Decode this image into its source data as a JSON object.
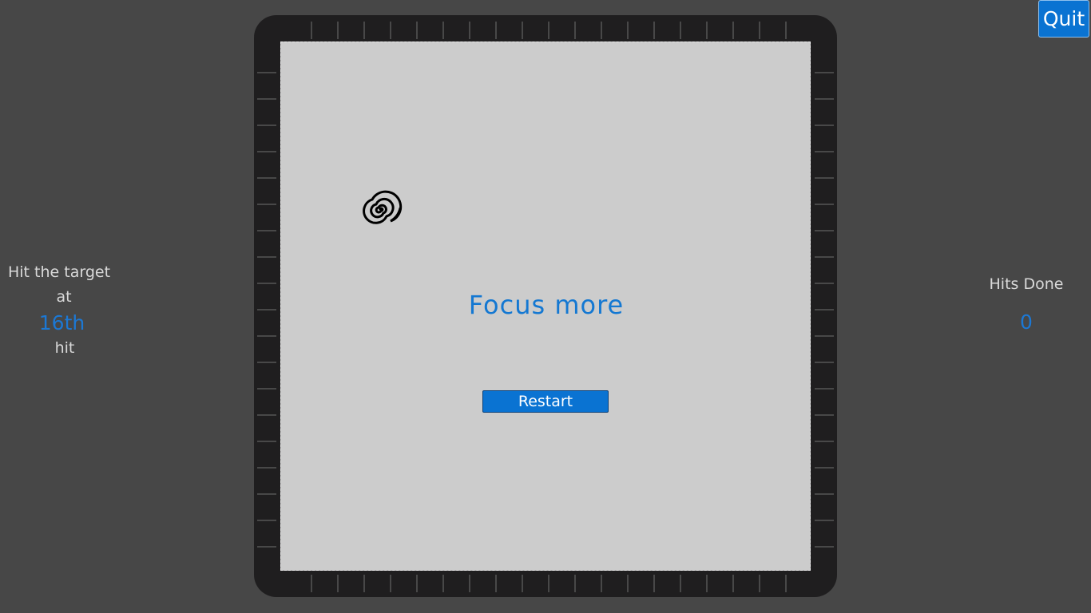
{
  "controls": {
    "quit_label": "Quit",
    "restart_label": "Restart"
  },
  "left_panel": {
    "instruction": "Hit the target",
    "at_word": "at",
    "target_hit": "16th",
    "hit_word": "hit"
  },
  "right_panel": {
    "hits_label": "Hits Done",
    "hits_value": "0"
  },
  "board": {
    "message": "Focus more",
    "target_icon": "spiral-target-icon"
  },
  "colors": {
    "background": "#474747",
    "frame": "#1f1e1f",
    "play_area": "#cccccc",
    "accent_blue": "#0a73d2",
    "text_light": "#d9d9d9"
  }
}
